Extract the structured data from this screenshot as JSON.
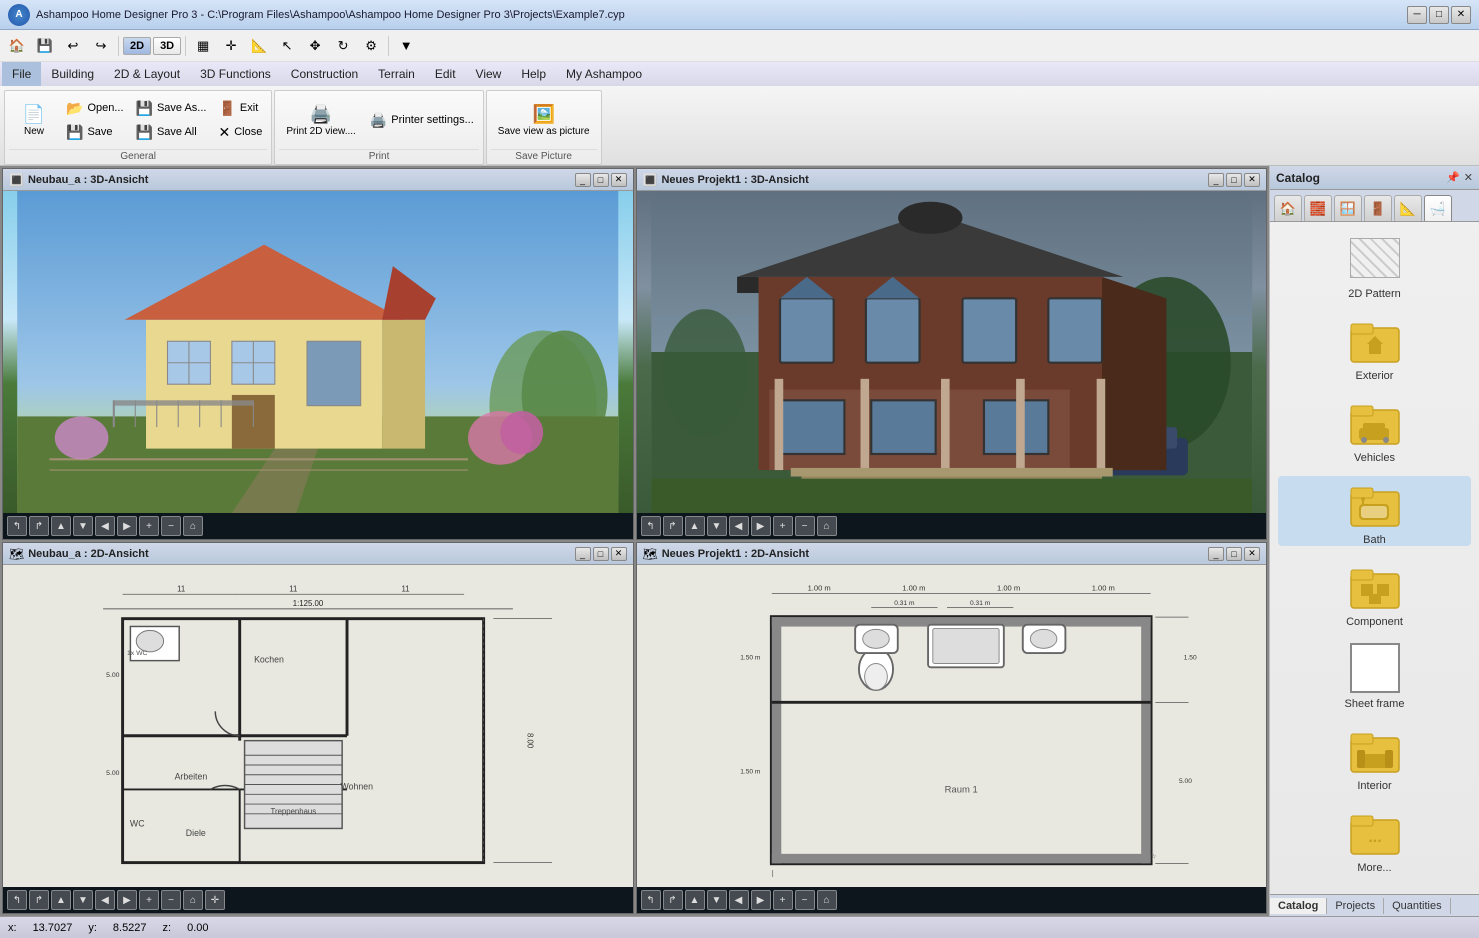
{
  "app": {
    "title": "Ashampoo Home Designer Pro 3 - C:\\Program Files\\Ashampoo\\Ashampoo Home Designer Pro 3\\Projects\\Example7.cyp",
    "logo_text": "A"
  },
  "titlebar": {
    "minimize": "─",
    "restore": "□",
    "close": "✕"
  },
  "quick_toolbar": {
    "buttons": [
      "🏠",
      "💾",
      "↩",
      "↪"
    ],
    "mode_2d": "2D",
    "mode_3d": "3D"
  },
  "menubar": {
    "items": [
      "File",
      "Building",
      "2D & Layout",
      "3D Functions",
      "Construction",
      "Terrain",
      "Edit",
      "View",
      "Help",
      "My Ashampoo"
    ]
  },
  "ribbon": {
    "groups": [
      {
        "label": "General",
        "buttons": [
          {
            "label": "New",
            "icon": "📄",
            "size": "large"
          },
          {
            "label": "Open...",
            "icon": "📂",
            "size": "small"
          },
          {
            "label": "Save",
            "icon": "💾",
            "size": "small"
          }
        ],
        "buttons2": [
          {
            "label": "Save As...",
            "icon": "💾",
            "size": "small"
          },
          {
            "label": "Save All",
            "icon": "💾",
            "size": "small"
          },
          {
            "label": "Close",
            "icon": "✕",
            "size": "small"
          }
        ],
        "buttons3": [
          {
            "label": "Exit",
            "icon": "🚪",
            "size": "small"
          }
        ]
      },
      {
        "label": "Print",
        "buttons": [
          {
            "label": "Print 2D view....",
            "icon": "🖨️",
            "size": "large"
          },
          {
            "label": "Printer settings...",
            "icon": "🖨️",
            "size": "small"
          }
        ]
      },
      {
        "label": "Save Picture",
        "buttons": [
          {
            "label": "Save view as picture",
            "icon": "🖼️",
            "size": "large"
          }
        ]
      }
    ]
  },
  "viewports": [
    {
      "id": "vp-3d-1",
      "title": "Neubau_a : 3D-Ansicht",
      "type": "3d",
      "scene": "yellow_house"
    },
    {
      "id": "vp-3d-2",
      "title": "Neues Projekt1 : 3D-Ansicht",
      "type": "3d",
      "scene": "dark_house"
    },
    {
      "id": "vp-2d-1",
      "title": "Neubau_a : 2D-Ansicht",
      "type": "2d",
      "scene": "floor_plan_1"
    },
    {
      "id": "vp-2d-2",
      "title": "Neues Projekt1 : 2D-Ansicht",
      "type": "2d",
      "scene": "floor_plan_2"
    }
  ],
  "catalog": {
    "title": "Catalog",
    "tabs": [
      {
        "label": "🏠",
        "active": false
      },
      {
        "label": "🧱",
        "active": false
      },
      {
        "label": "🪟",
        "active": false
      },
      {
        "label": "🚪",
        "active": false
      },
      {
        "label": "📦",
        "active": false
      },
      {
        "label": "🛁",
        "active": true
      }
    ],
    "items": [
      {
        "label": "2D Pattern",
        "type": "pattern"
      },
      {
        "label": "Exterior",
        "type": "folder"
      },
      {
        "label": "Vehicles",
        "type": "folder"
      },
      {
        "label": "Bath",
        "type": "folder",
        "selected": true
      },
      {
        "label": "Component",
        "type": "folder"
      },
      {
        "label": "Sheet frame",
        "type": "sheet"
      },
      {
        "label": "Interior",
        "type": "folder"
      },
      {
        "label": "More...",
        "type": "folder"
      }
    ],
    "bottom_tabs": [
      {
        "label": "Catalog",
        "active": true
      },
      {
        "label": "Projects",
        "active": false
      },
      {
        "label": "Quantities",
        "active": false
      }
    ]
  },
  "statusbar": {
    "x_label": "x:",
    "x_value": "13.7027",
    "y_label": "y:",
    "y_value": "8.5227",
    "z_label": "z:",
    "z_value": "0.00"
  }
}
